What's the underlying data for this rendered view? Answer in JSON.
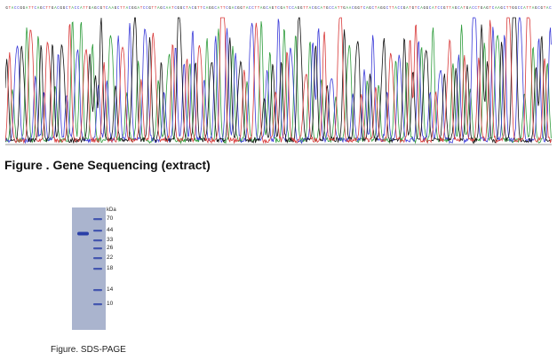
{
  "sequencing": {
    "bases": "GTACCGGATTCAGCTTGACGGCTACCATTGAGCGTCAAGCTTACGGATCCGTTAGCAATCGGCTACGTTCAGGCATTCGACGGTACCTTAGCAGTCGATCCAGGTTACGCATGCCATTGAACGGTCAGCTAGGCTTACCGATGTCAGGCATCCGTTAGCATGACCTGAGTCAAGCTTGGCCATTAGCGTAC",
    "channel_colors": {
      "A": "#2e9c3b",
      "C": "#3b3bd8",
      "G": "#111111",
      "T": "#d83a3a"
    }
  },
  "figure1": {
    "caption": "Figure . Gene Sequencing (extract)"
  },
  "gel": {
    "unit_label": "kDa",
    "markers": [
      "70",
      "44",
      "33",
      "26",
      "22",
      "18",
      "14",
      "10"
    ],
    "sample_band_kda": "44",
    "gel_color": "#aab4ce",
    "band_color": "#2a3fa8"
  },
  "figure2": {
    "caption": "Figure. SDS-PAGE"
  }
}
